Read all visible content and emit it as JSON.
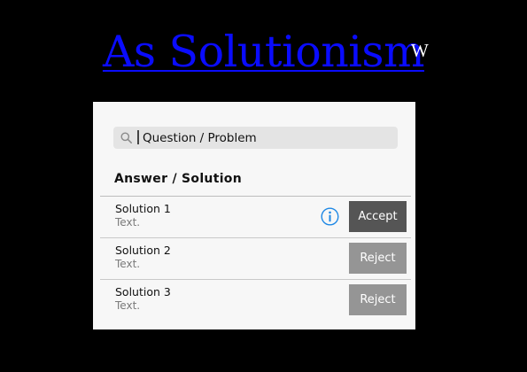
{
  "app": {
    "title": "As Solutionism",
    "wiki_mark": "W",
    "title_color": "#0a0cff"
  },
  "search": {
    "placeholder": "Question / Problem",
    "value": "",
    "icon": "search-icon"
  },
  "answers": {
    "header": "Answer / Solution",
    "items": [
      {
        "title": "Solution 1",
        "subtitle": "Text.",
        "has_info": true,
        "action": "Accept",
        "action_color": "#555555"
      },
      {
        "title": "Solution 2",
        "subtitle": "Text.",
        "has_info": false,
        "action": "Reject",
        "action_color": "#959595"
      },
      {
        "title": "Solution 3",
        "subtitle": "Text.",
        "has_info": false,
        "action": "Reject",
        "action_color": "#959595"
      }
    ],
    "info_icon": "info-icon",
    "info_icon_color": "#1e88e5"
  }
}
